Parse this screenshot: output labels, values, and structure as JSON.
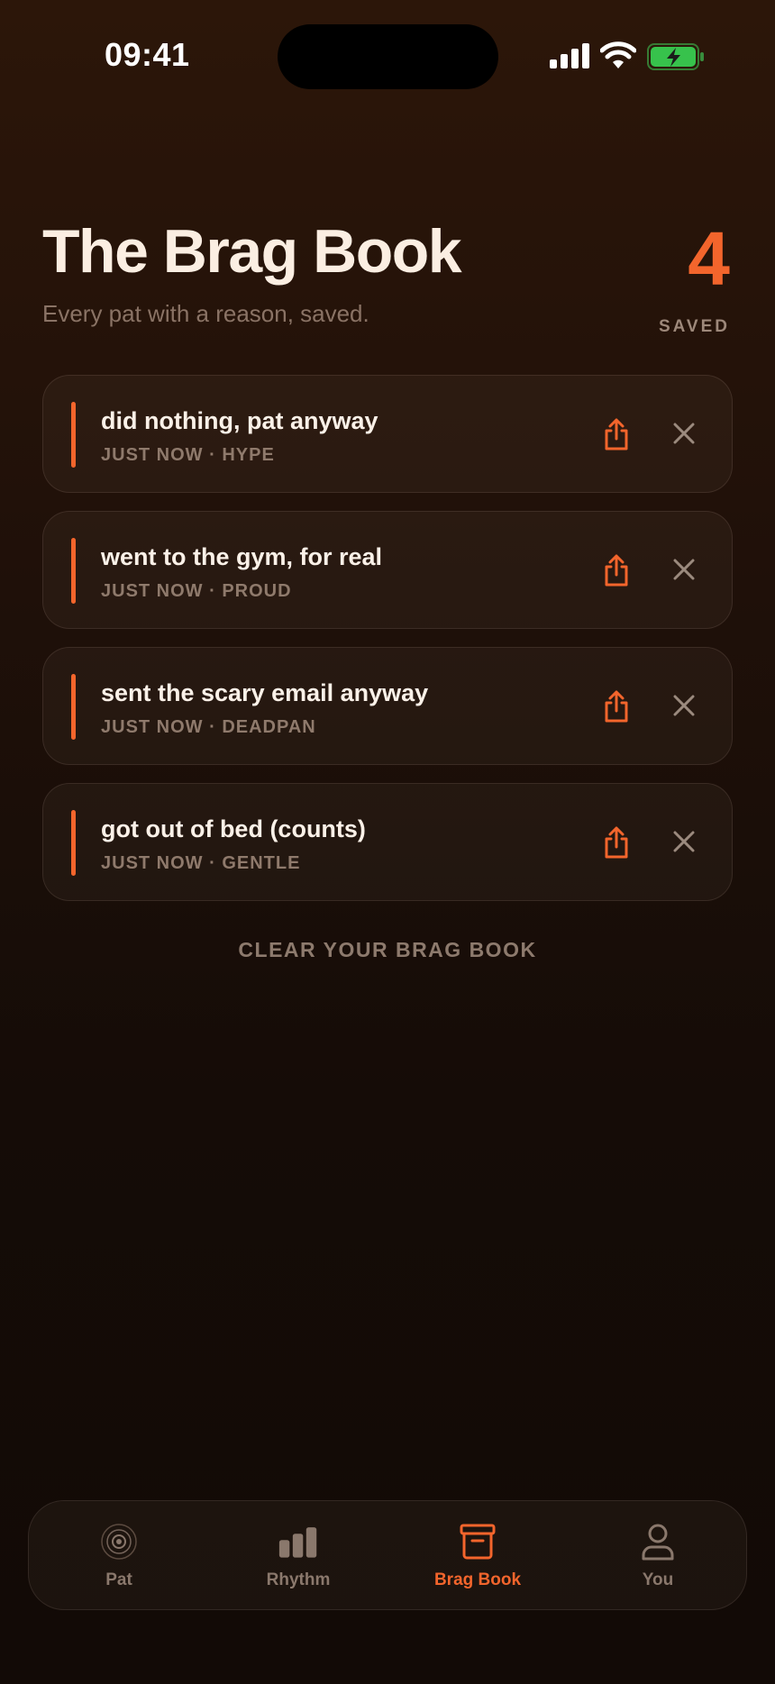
{
  "status": {
    "time": "09:41"
  },
  "header": {
    "title": "The Brag Book",
    "subtitle": "Every pat with a reason, saved.",
    "count": "4",
    "count_label": "SAVED"
  },
  "entries": [
    {
      "text": "did nothing, pat anyway",
      "meta": "JUST NOW · HYPE"
    },
    {
      "text": "went to the gym, for real",
      "meta": "JUST NOW · PROUD"
    },
    {
      "text": "sent the scary email anyway",
      "meta": "JUST NOW · DEADPAN"
    },
    {
      "text": "got out of bed (counts)",
      "meta": "JUST NOW · GENTLE"
    }
  ],
  "clear_label": "CLEAR YOUR BRAG BOOK",
  "tabs": [
    {
      "label": "Pat",
      "icon": "target-icon"
    },
    {
      "label": "Rhythm",
      "icon": "bars-icon"
    },
    {
      "label": "Brag Book",
      "icon": "archive-box-icon",
      "active": true
    },
    {
      "label": "You",
      "icon": "user-icon"
    }
  ],
  "colors": {
    "accent": "#f3652c",
    "background": "#1f1009"
  }
}
